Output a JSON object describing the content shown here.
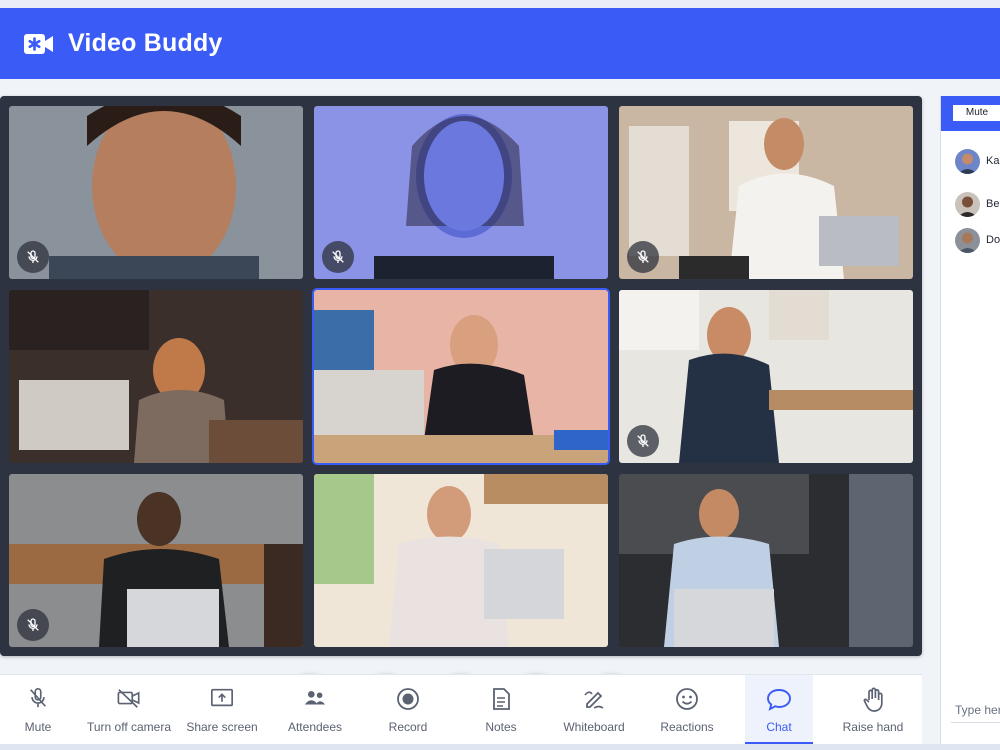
{
  "app": {
    "title": "Video Buddy",
    "icon": "video-camera-icon",
    "accent": "#3b5bf6"
  },
  "controls": [
    {
      "name": "microphone-button",
      "icon": "microphone-icon"
    },
    {
      "name": "camera-button",
      "icon": "video-camera-icon"
    },
    {
      "name": "share-screen-button",
      "icon": "screen-share-icon"
    },
    {
      "name": "more-options-button",
      "icon": "more-vertical-icon"
    },
    {
      "name": "end-call-button",
      "icon": "phone-hangup-icon",
      "color": "#ea3b3b"
    }
  ],
  "side_panel": {
    "mute_label": "Mute",
    "participants": [
      {
        "name": "Ka"
      },
      {
        "name": "Be"
      },
      {
        "name": "Do"
      }
    ],
    "input_placeholder": "Type here"
  },
  "toolbar": {
    "items": [
      {
        "label": "Mute",
        "icon": "microphone-off-icon"
      },
      {
        "label": "Turn off camera",
        "icon": "camera-off-icon"
      },
      {
        "label": "Share screen",
        "icon": "screen-share-icon"
      },
      {
        "label": "Attendees",
        "icon": "people-icon"
      },
      {
        "label": "Record",
        "icon": "record-icon"
      },
      {
        "label": "Notes",
        "icon": "document-icon"
      },
      {
        "label": "Whiteboard",
        "icon": "pencil-draw-icon"
      },
      {
        "label": "Reactions",
        "icon": "smiley-icon"
      },
      {
        "label": "Chat",
        "icon": "chat-bubble-icon",
        "active": true
      },
      {
        "label": "Raise hand",
        "icon": "hand-icon"
      }
    ]
  }
}
